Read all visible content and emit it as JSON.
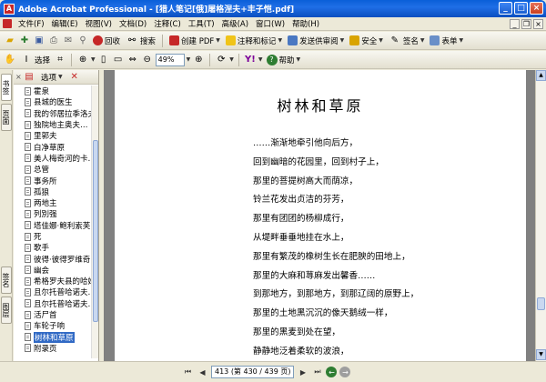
{
  "window": {
    "title": "Adobe Acrobat Professional - [猎人笔记[俄]屠格涅夫+丰子恺.pdf]"
  },
  "menu": [
    "文件(F)",
    "编辑(E)",
    "视图(V)",
    "文档(D)",
    "注释(C)",
    "工具(T)",
    "高级(A)",
    "窗口(W)",
    "帮助(H)"
  ],
  "toolbar1": {
    "organizer": "回收",
    "search": "搜索",
    "create_pdf": "创建 PDF",
    "review": "注释和标记",
    "send_review": "发送供审阅",
    "secure": "安全",
    "sign": "签名",
    "forms": "表单"
  },
  "toolbar2": {
    "select": "选择",
    "zoom": "49%",
    "help": "帮助"
  },
  "nav_tabs": [
    "书签",
    "页面",
    "签名",
    "图层"
  ],
  "panel": {
    "options": "选项"
  },
  "bookmarks": [
    "霍泉",
    "县城的医生",
    "我的邻居拉季洛夫",
    "独院地主奥夫…",
    "里郭夫",
    "白净草原",
    "美人梅奇河的卡…",
    "总管",
    "事务所",
    "孤狼",
    "两地主",
    "列別强",
    "塔佳娜·鲍利索芙…",
    "死",
    "歌手",
    "彼得·彼得罗维奇…",
    "幽会",
    "希格罗夫县的哈姆…",
    "且尔托普哈诺夫…",
    "且尔托普哈诺夫…",
    "活尸首",
    "车轮子响",
    "树林和草原",
    "附录页"
  ],
  "selected_bookmark": "树林和草原",
  "page": {
    "title": "树林和草原",
    "lines": [
      "……渐渐地牵引他向后方，",
      "回到幽暗的花园里，回到村子上，",
      "那里的菩提树高大而荫凉，",
      "铃兰花发出贞洁的芬芳，",
      "那里有团团的杨柳成行，",
      "从堤畔垂垂地挂在水上，",
      "那里有繁茂的橡树生长在肥腴的田地上，",
      "那里的大麻和荨麻发出馨香……",
      "到那地方，到那地方，到那辽阔的原野上，",
      "那里的土地黑沉沉的像天鹅绒一样，",
      "那里的黑麦到处在望，",
      "静静地泛着柔软的波浪，",
      "从一团团明净的白云中央，"
    ]
  },
  "status": {
    "page_counter": "413 (第 430 / 439 页)"
  },
  "colors": {
    "titlebar": "#0a5fd8",
    "selection": "#316ac5",
    "doc_background": "#808080"
  }
}
